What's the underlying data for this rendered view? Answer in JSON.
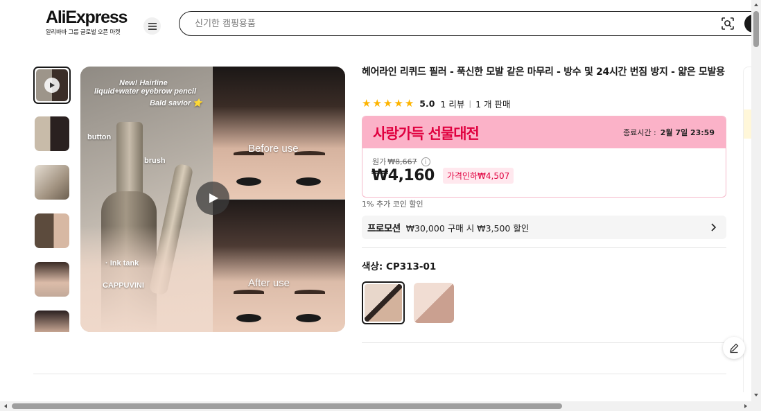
{
  "header": {
    "logo_text": "AliExpress",
    "logo_sub": "알리바바 그룹 글로벌 오픈 마켓",
    "search_placeholder": "신기한 캠핑용품"
  },
  "gallery": {
    "image_labels": {
      "new": "New!  Hairline",
      "product": "liquid+water eyebrow pencil",
      "savior": "Bald savior ⭐",
      "button": "button",
      "brush": "brush",
      "ink_tank": "· Ink tank",
      "brand": "CAPPUVINI",
      "before": "Before use",
      "after": "After use"
    }
  },
  "product": {
    "title": "헤어라인 리퀴드 필러 - 푹신한 모발 같은 마무리 - 방수 및 24시간 번짐 방지 - 얇은 모발용",
    "rating": "5.0",
    "reviews": "1 리뷰",
    "sold": "1 개 판매",
    "stars": 5,
    "promo_banner": "사랑가득 선물대전",
    "end_time_label": "종료시간 :",
    "end_time_value": "2월 7일 23:59",
    "original_label": "원가",
    "original_price": "₩8,667",
    "price": "₩4,160",
    "discount": "가격인하₩4,507",
    "coin_note": "1% 추가 코인 할인",
    "promotion_label": "프로모션",
    "promotion_text": "₩30,000 구매 시 ₩3,500 할인",
    "color_label": "색상: CP313-01"
  },
  "colors": {
    "accent_red": "#e0003f",
    "banner_pink": "#fbb2c8",
    "star_gold": "#fdb400"
  }
}
